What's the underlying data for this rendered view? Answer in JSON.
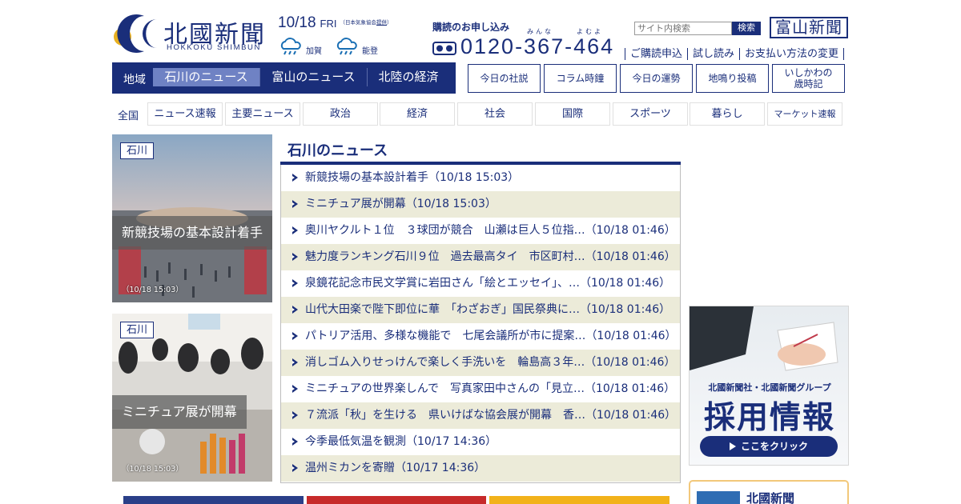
{
  "header": {
    "logo_kanji": "北國新聞",
    "logo_roman": "HOKKOKU SHIMBUN",
    "date": "10/18",
    "day_of_week": "FRI",
    "weather_note": "（日本気象協会",
    "weather_note_link": "提供",
    "weather_note_end": "）",
    "weather": [
      {
        "label": "加賀",
        "icon": "rain-cloud-icon"
      },
      {
        "label": "能登",
        "icon": "rain-cloud-icon"
      }
    ],
    "subscribe_title": "購読のお申し込み",
    "subscribe_ruby_1": "みんな",
    "subscribe_ruby_2": "よむよ",
    "phone": "0120-367-464",
    "search_placeholder": "サイト内検索",
    "search_button": "検索",
    "toyama_link": "富山新聞",
    "util_links": [
      "ご購読申込",
      "試し読み",
      "お支払い方法の変更"
    ]
  },
  "region_nav": {
    "label": "地域",
    "tabs": [
      "石川のニュース",
      "富山のニュース",
      "北陸の経済"
    ],
    "active_index": 0
  },
  "feature_buttons": [
    "今日の社説",
    "コラム時鐘",
    "今日の運勢",
    "地鳴り投稿",
    "いしかわの\n歳時記"
  ],
  "category_nav": {
    "label": "全国",
    "items": [
      "ニュース速報",
      "主要ニュース",
      "政治",
      "経済",
      "社会",
      "国際",
      "スポーツ",
      "暮らし",
      "マーケット速報"
    ]
  },
  "photo_cards": [
    {
      "tag": "石川",
      "caption": "新競技場の基本設計着手",
      "time": "（10/18 15:03）"
    },
    {
      "tag": "石川",
      "caption": "ミニチュア展が開幕",
      "time": "（10/18 15:03）"
    }
  ],
  "news": {
    "heading": "石川のニュース",
    "items": [
      "新競技場の基本設計着手（10/18 15:03）",
      "ミニチュア展が開幕（10/18 15:03）",
      "奥川ヤクルト１位　３球団が競合　山瀬は巨人５位指…（10/18 01:46）",
      "魅力度ランキング石川９位　過去最高タイ　市区町村…（10/18 01:46）",
      "泉鏡花記念市民文学賞に岩田さん「絵とエッセイ」、…（10/18 01:46）",
      "山代大田楽で陛下即位に華　「わざおぎ」国民祭典に…（10/18 01:46）",
      "パトリア活用、多様な機能で　七尾会議所が市に提案…（10/18 01:46）",
      "消しゴム入りせっけんで楽しく手洗いを　輪島高３年…（10/18 01:46）",
      "ミニチュアの世界楽しんで　写真家田中さんの「見立…（10/18 01:46）",
      "７流派「秋」を生ける　県いけばな協会展が開幕　香…（10/18 01:46）",
      "今季最低気温を観測（10/17 14:36）",
      "温州ミカンを寄贈（10/17 14:36）"
    ]
  },
  "recruit_banner": {
    "sub": "北國新聞社・北國新聞グループ",
    "main": "採用情報",
    "cta": "ここをクリック"
  },
  "bottom_card": {
    "text": "北國新聞"
  },
  "colors": {
    "brand_navy": "#1a2e7a",
    "active_tab": "#6f82c4",
    "list_alt_row": "#ecebd9",
    "card_border": "#f2c87a"
  }
}
